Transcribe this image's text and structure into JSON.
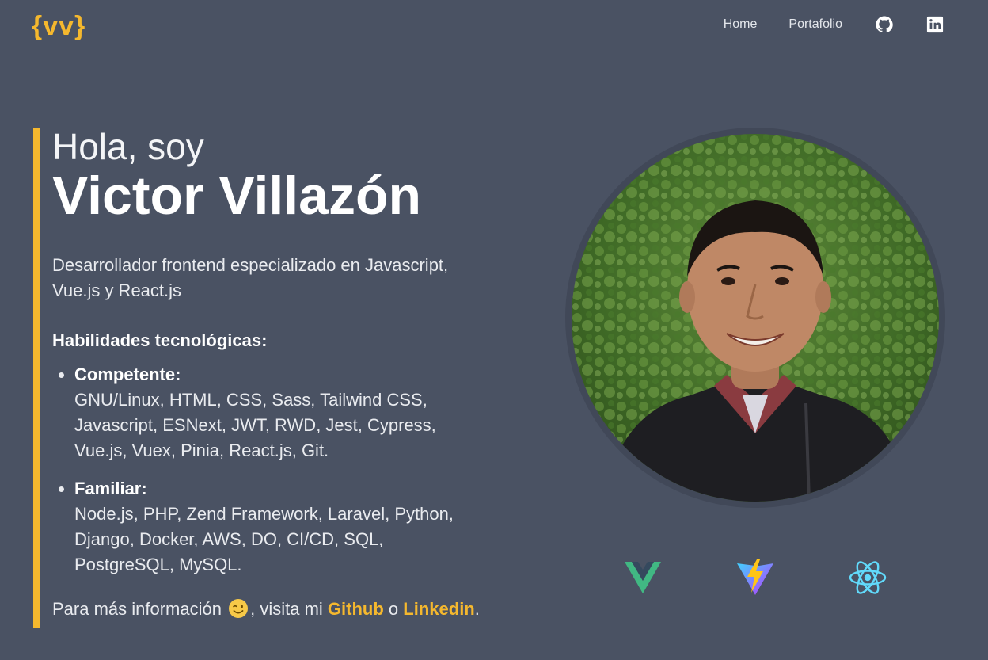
{
  "header": {
    "logo": "{vv}",
    "nav": [
      {
        "label": "Home"
      },
      {
        "label": "Portafolio"
      }
    ],
    "icons": [
      "github-icon",
      "linkedin-icon"
    ]
  },
  "hero": {
    "greeting": "Hola, soy",
    "name": "Victor Villazón",
    "role": "Desarrollador frontend especializado en Javascript, Vue.js y React.js",
    "skills_title": "Habilidades tecnológicas:",
    "skills": [
      {
        "label": "Competente:",
        "items": "GNU/Linux, HTML, CSS, Sass, Tailwind CSS, Javascript, ESNext, JWT, RWD, Jest, Cypress, Vue.js, Vuex, Pinia, React.js, Git."
      },
      {
        "label": "Familiar:",
        "items": "Node.js, PHP, Zend Framework, Laravel, Python, Django, Docker, AWS, DO, CI/CD, SQL, PostgreSQL, MySQL."
      }
    ],
    "more_prefix": "Para más información",
    "more_middle": ", visita mi",
    "github_link": "Github",
    "or": "o",
    "linkedin_link": "Linkedin",
    "period": "."
  },
  "tech_icons": [
    "vue-icon",
    "vite-icon",
    "react-icon"
  ],
  "colors": {
    "background": "#4a5263",
    "accent": "#f5b82e",
    "text": "#ffffff"
  }
}
